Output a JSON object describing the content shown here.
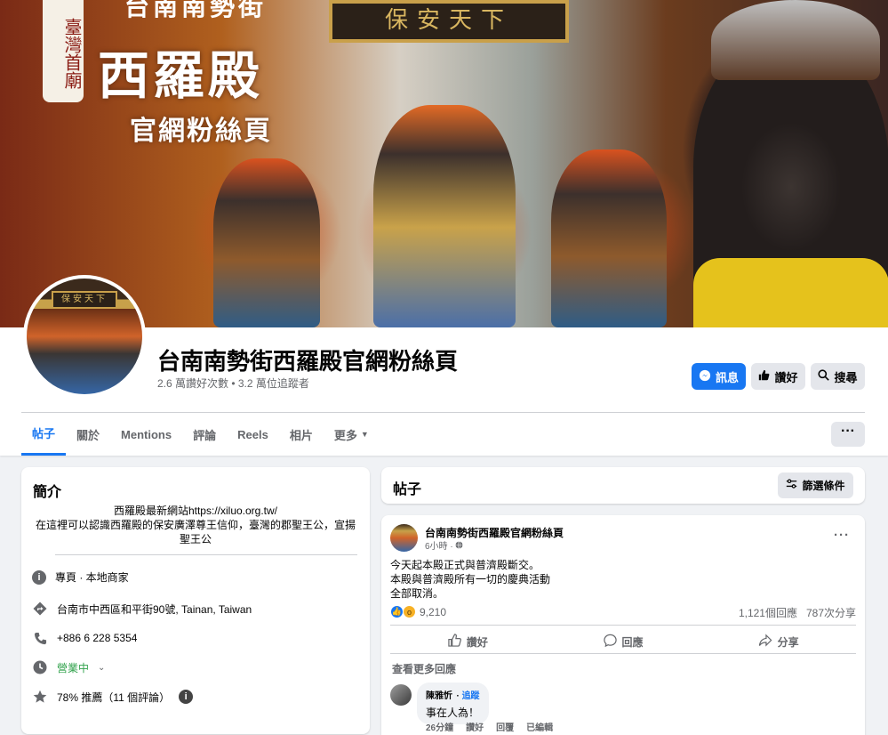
{
  "cover": {
    "plaque_text": "保安天下",
    "top_text": "台南南勢街",
    "vertical_text": "臺灣首廟",
    "big_title": "西羅殿",
    "subtitle": "官網粉絲頁"
  },
  "page": {
    "name": "台南南勢街西羅殿官網粉絲頁",
    "stats": "2.6 萬讚好次數 • 3.2 萬位追蹤者",
    "avatar_plaque": "保安天下"
  },
  "buttons": {
    "message": "訊息",
    "like": "讚好",
    "search": "搜尋",
    "more": "···"
  },
  "tabs": [
    {
      "label": "帖子"
    },
    {
      "label": "關於"
    },
    {
      "label": "Mentions"
    },
    {
      "label": "評論"
    },
    {
      "label": "Reels"
    },
    {
      "label": "相片"
    },
    {
      "label": "更多"
    }
  ],
  "intro": {
    "title": "簡介",
    "bio_line1": "西羅殿最新網站https://xiluo.org.tw/",
    "bio_line2": "在這裡可以認識西羅殿的保安廣澤尊王信仰，臺灣的郡聖王公，宣揚",
    "bio_line3": "聖王公",
    "category": "專頁 · 本地商家",
    "address": "台南市中西區和平街90號, Tainan, Taiwan",
    "phone": "+886 6 228 5354",
    "hours": "營業中",
    "rating": "78% 推薦（11 個評論）"
  },
  "posts_section": {
    "title": "帖子",
    "filter_label": "篩選條件"
  },
  "post": {
    "author": "台南南勢街西羅殿官網粉絲頁",
    "time": "6小時 ·",
    "text_line1": "今天起本殿正式與普濟殿斷交。",
    "text_line2": "本殿與普濟殿所有一切的慶典活動",
    "text_line3": "全部取消。",
    "reaction_count": "9,210",
    "comment_count": "1,121個回應",
    "share_count": "787次分享",
    "action_like": "讚好",
    "action_comment": "回應",
    "action_share": "分享",
    "more_comments": "查看更多回應",
    "comment": {
      "author": "陳雅忻",
      "follow": "追蹤",
      "text": "事在人為！",
      "time": "26分鐘",
      "like": "讚好",
      "reply": "回覆",
      "edited": "已編輯"
    }
  },
  "colors": {
    "accent": "#1877f2",
    "background": "#f0f2f5",
    "open_status": "#31a24c"
  }
}
